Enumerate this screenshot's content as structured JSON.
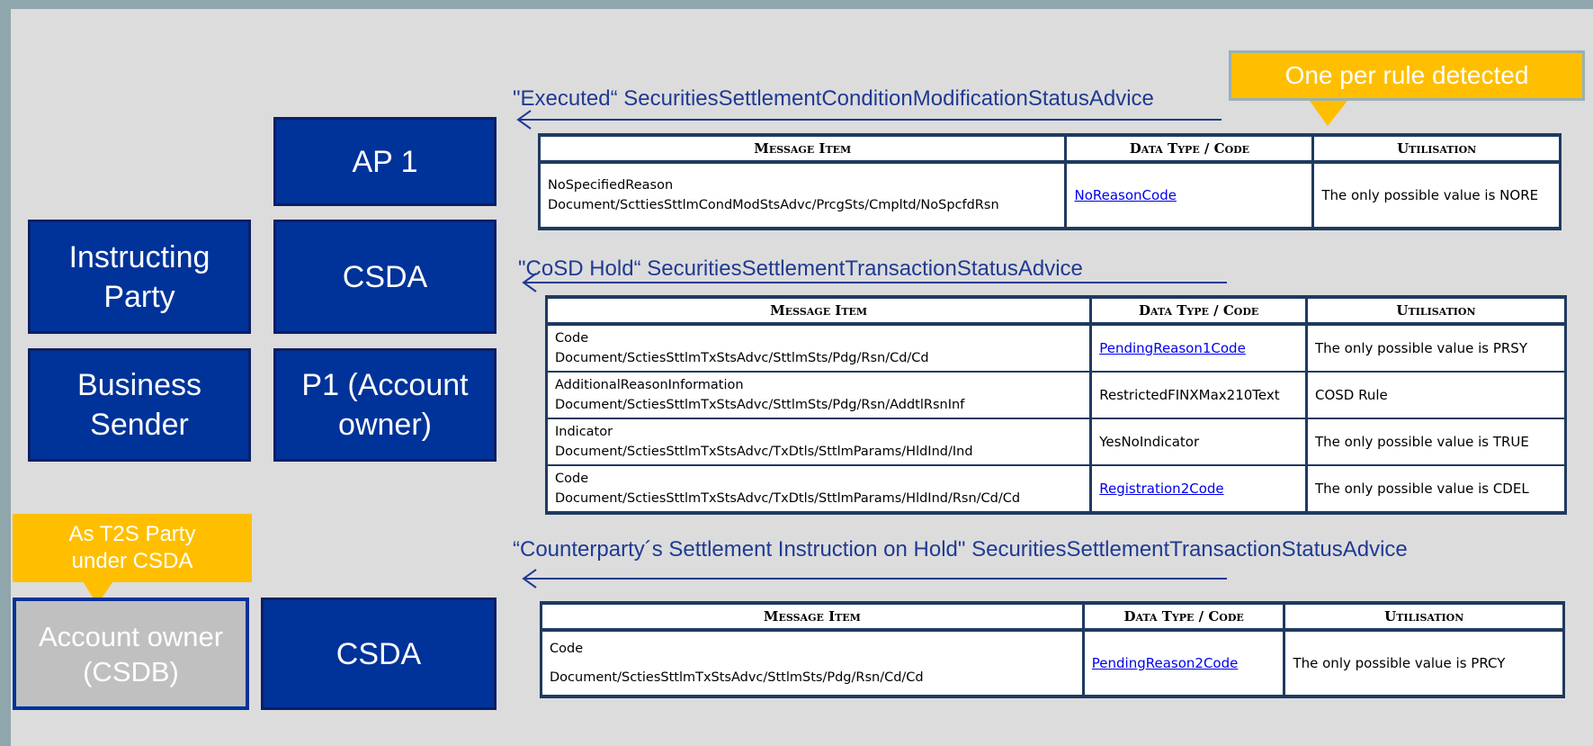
{
  "callouts": {
    "rule": "One per rule detected",
    "t2s": "As T2S Party\nunder CSDA"
  },
  "boxes": {
    "ap1": "AP 1",
    "instructing_party": "Instructing\nParty",
    "csda_top": "CSDA",
    "business_sender": "Business\nSender",
    "p1": "P1 (Account\nowner)",
    "account_owner": "Account owner\n(CSDB)",
    "csda_bottom": "CSDA"
  },
  "messages": [
    {
      "title": "\"Executed“ SecuritiesSettlementConditionModificationStatusAdvice",
      "headers": [
        "Message Item",
        "Data Type / Code",
        "Utilisation"
      ],
      "rows": [
        {
          "item": "NoSpecifiedReason",
          "path": "Document/ScttiesSttlmCondModStsAdvc/PrcgSts/Cmpltd/NoSpcfdRsn",
          "type": "NoReasonCode",
          "type_is_link": true,
          "utilisation": "The only possible value is NORE"
        }
      ]
    },
    {
      "title": "\"CoSD Hold“ SecuritiesSettlementTransactionStatusAdvice",
      "headers": [
        "Message Item",
        "Data Type / Code",
        "Utilisation"
      ],
      "rows": [
        {
          "item": "Code",
          "path": "Document/SctiesSttlmTxStsAdvc/SttlmSts/Pdg/Rsn/Cd/Cd",
          "type": "PendingReason1Code",
          "type_is_link": true,
          "utilisation": "The only possible value is PRSY"
        },
        {
          "item": "AdditionalReasonInformation",
          "path": "Document/SctiesSttlmTxStsAdvc/SttlmSts/Pdg/Rsn/AddtlRsnInf",
          "type": "RestrictedFINXMax210Text",
          "type_is_link": false,
          "utilisation": "COSD Rule"
        },
        {
          "item": "Indicator",
          "path": "Document/SctiesSttlmTxStsAdvc/TxDtls/SttlmParams/HldInd/Ind",
          "type": "YesNoIndicator",
          "type_is_link": false,
          "utilisation": "The only possible value is TRUE"
        },
        {
          "item": "Code",
          "path": "Document/SctiesSttlmTxStsAdvc/TxDtls/SttlmParams/HldInd/Rsn/Cd/Cd",
          "type": "Registration2Code",
          "type_is_link": true,
          "utilisation": "The only possible value is CDEL"
        }
      ]
    },
    {
      "title": "“Counterparty´s Settlement Instruction on Hold\" SecuritiesSettlementTransactionStatusAdvice",
      "headers": [
        "Message Item",
        "Data Type / Code",
        "Utilisation"
      ],
      "rows": [
        {
          "item": "Code",
          "path": "Document/SctiesSttlmTxStsAdvc/SttlmSts/Pdg/Rsn/Cd/Cd",
          "type": "PendingReason2Code",
          "type_is_link": true,
          "utilisation": "The only possible value is PRCY"
        }
      ]
    }
  ],
  "colors": {
    "background": "#dcdcdc",
    "frame": "#8fa6ac",
    "box_blue": "#003399",
    "box_grey": "#c0c0c0",
    "callout": "#ffbf00",
    "title_text": "#1f3a93",
    "table_border": "#1f3a5f"
  }
}
